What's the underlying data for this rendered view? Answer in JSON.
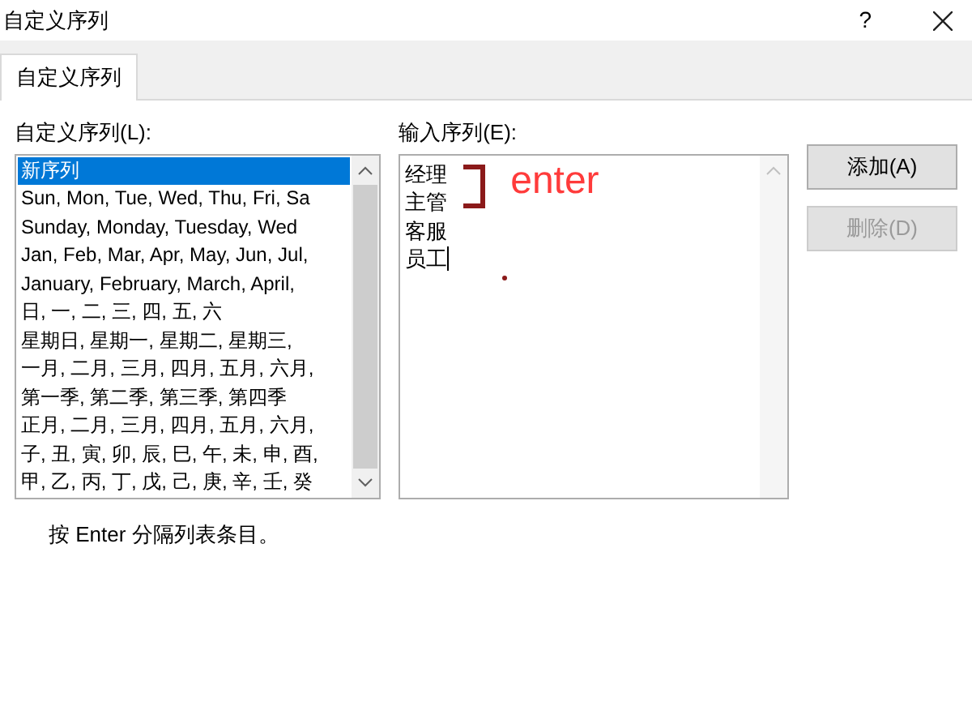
{
  "window": {
    "title": "自定义序列",
    "help": "?"
  },
  "tabs": [
    {
      "label": "自定义序列",
      "selected": true
    }
  ],
  "list": {
    "label": "自定义序列(L):",
    "items": [
      {
        "text": "新序列",
        "selected": true
      },
      {
        "text": "Sun, Mon, Tue, Wed, Thu, Fri, Sa",
        "selected": false
      },
      {
        "text": "Sunday, Monday, Tuesday, Wed",
        "selected": false
      },
      {
        "text": "Jan, Feb, Mar, Apr, May, Jun, Jul,",
        "selected": false
      },
      {
        "text": "January, February, March, April,",
        "selected": false
      },
      {
        "text": "日, 一, 二, 三, 四, 五, 六",
        "selected": false
      },
      {
        "text": "星期日, 星期一, 星期二, 星期三,",
        "selected": false
      },
      {
        "text": "一月, 二月, 三月, 四月, 五月, 六月,",
        "selected": false
      },
      {
        "text": "第一季, 第二季, 第三季, 第四季",
        "selected": false
      },
      {
        "text": "正月, 二月, 三月, 四月, 五月, 六月,",
        "selected": false
      },
      {
        "text": "子, 丑, 寅, 卯, 辰, 巳, 午, 未, 申, 酉,",
        "selected": false
      },
      {
        "text": "甲, 乙, 丙, 丁, 戊, 己, 庚, 辛, 壬, 癸",
        "selected": false
      }
    ]
  },
  "entries": {
    "label": "输入序列(E):",
    "lines": [
      "经理",
      "主管",
      "客服",
      "员工"
    ],
    "annotation": "enter"
  },
  "buttons": [
    {
      "label": "添加(A)",
      "disabled": false
    },
    {
      "label": "删除(D)",
      "disabled": true
    }
  ],
  "hint": "按 Enter 分隔列表条目。"
}
